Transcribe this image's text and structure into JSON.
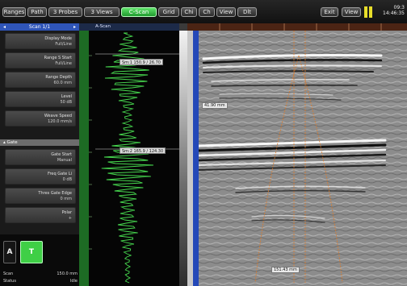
{
  "toolbar": {
    "buttons": [
      {
        "label": "Ranges",
        "active": false
      },
      {
        "label": "Path",
        "active": false
      },
      {
        "label": "3 Probes",
        "active": false
      },
      {
        "label": "3 Views",
        "active": false
      },
      {
        "label": "C-Scan",
        "active": true
      },
      {
        "label": "Grid",
        "active": false
      },
      {
        "label": "Chi",
        "active": false
      },
      {
        "label": "Ch",
        "active": false
      },
      {
        "label": "View",
        "active": false
      },
      {
        "label": "Dlt",
        "active": false
      }
    ],
    "right_buttons": [
      {
        "label": "Exit"
      },
      {
        "label": "View"
      }
    ],
    "clock_line1": "09:3",
    "clock_line2": "14:46:35"
  },
  "left_panel": {
    "title": "Scan 1/1",
    "params_top": [
      {
        "label": "Display Mode",
        "value": "Full/Line"
      },
      {
        "label": "Range S Start",
        "value": "Full/Line"
      },
      {
        "label": "Range Depth",
        "value": "60.0 mm"
      },
      {
        "label": "Level",
        "value": "50 dB"
      },
      {
        "label": "Weave Speed",
        "value": "120.0 mm/s"
      }
    ],
    "section": "Gate",
    "params_bottom": [
      {
        "label": "Gate Start",
        "value": "Manual"
      },
      {
        "label": "Freq Gate Li",
        "value": "0 dB"
      },
      {
        "label": "Thres Gate Edge",
        "value": "0 mm"
      },
      {
        "label": "Polar",
        "value": "+"
      }
    ],
    "keys": [
      {
        "label": "A",
        "active": false
      },
      {
        "label": "T",
        "active": true
      }
    ],
    "status": [
      {
        "label": "Scan",
        "value": "150.0 mm"
      },
      {
        "label": "Status",
        "value": "Idle"
      }
    ]
  },
  "wave_panel": {
    "header": "A-Scan",
    "cursors": [
      {
        "text": "Sm:1 150.9 / 26.70"
      },
      {
        "text": "Sm:2 165.9 / 124.30"
      }
    ]
  },
  "scan_panel": {
    "measurements": [
      {
        "text": "41.90 mm"
      },
      {
        "text": "151.43 mm"
      }
    ]
  },
  "colors": {
    "accent_green": "#2fc13c",
    "title_blue": "#2f55b8",
    "battery": "#e8de2a",
    "cursor_orange": "#e07b27"
  }
}
